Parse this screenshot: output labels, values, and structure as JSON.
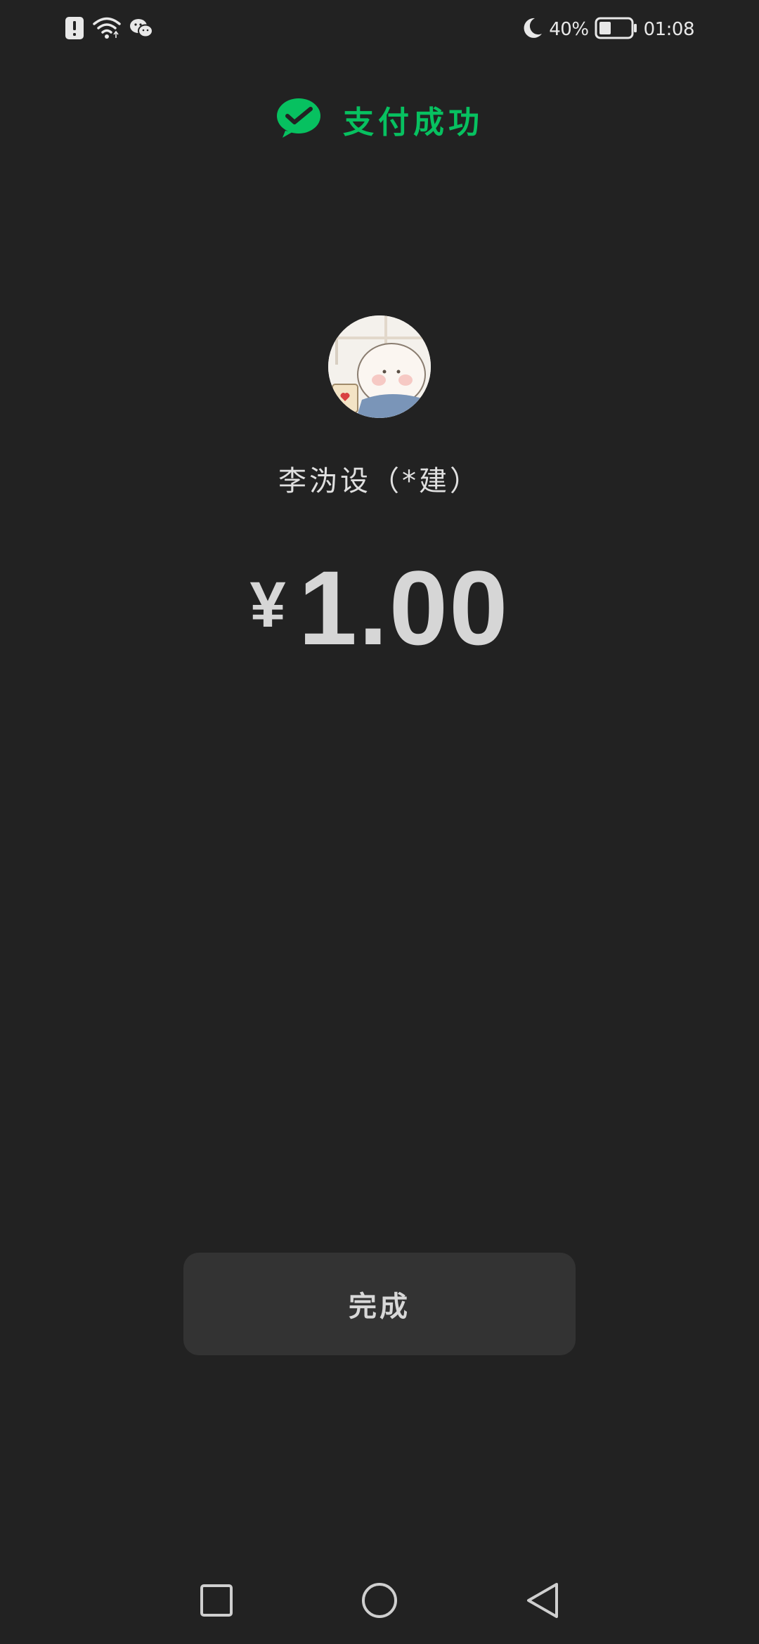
{
  "status_bar": {
    "battery_percent": "40%",
    "time": "01:08",
    "icons": [
      "alert-icon",
      "wifi-icon",
      "wechat-notification-icon",
      "moon-icon",
      "battery-icon"
    ]
  },
  "header": {
    "title": "支付成功",
    "icon": "wechat-pay-check-icon",
    "accent_color": "#07c160"
  },
  "payee": {
    "name": "李沩设（*建）"
  },
  "amount": {
    "currency": "¥",
    "value": "1.00"
  },
  "done_button": {
    "label": "完成"
  },
  "nav_bar": {
    "icons": [
      "recent-apps-icon",
      "home-icon",
      "back-icon"
    ]
  }
}
